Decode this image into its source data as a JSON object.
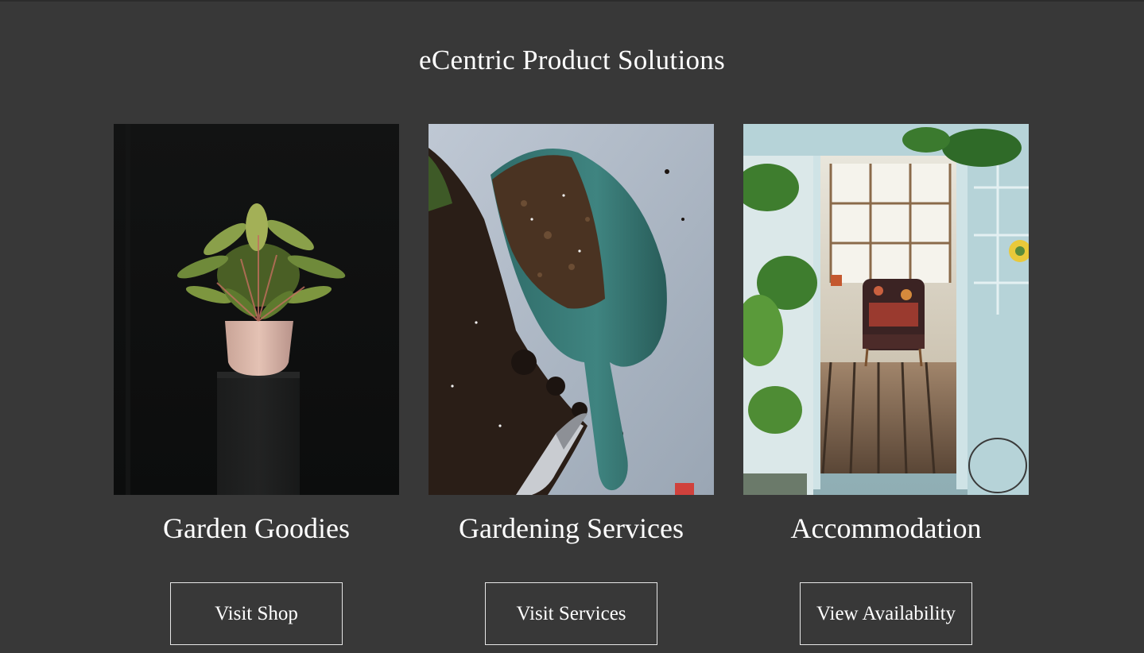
{
  "header": {
    "title": "eCentric Product Solutions"
  },
  "cards": [
    {
      "title": "Garden Goodies",
      "button_label": "Visit Shop",
      "image": "potted-plant-on-pedestal"
    },
    {
      "title": "Gardening Services",
      "button_label": "Visit Services",
      "image": "garden-trowel-with-soil"
    },
    {
      "title": "Accommodation",
      "button_label": "View Availability",
      "image": "greenhouse-room-with-armchair"
    }
  ],
  "colors": {
    "background": "#383838",
    "text": "#ffffff",
    "button_border": "#e6e6e6"
  }
}
